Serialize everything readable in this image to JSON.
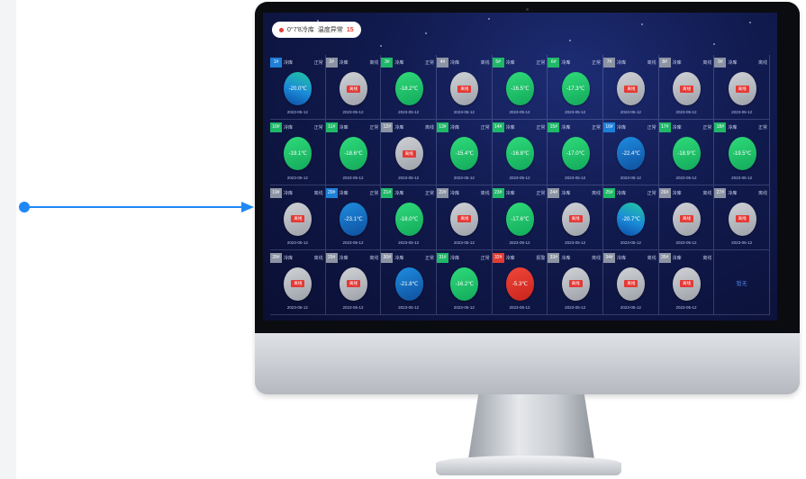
{
  "screen": {
    "header_prefix": "0°7'8冷库",
    "header_alert": "15",
    "header_mid": "温度异常"
  },
  "colors": {
    "connector": "#1e88f5",
    "normal": "#1fb868",
    "low": "#1e7fd8",
    "offline": "#8c93a3",
    "alarm": "#e23b32"
  },
  "cells": [
    {
      "tag": "1#",
      "tag_color": "blue",
      "name": "冷库",
      "state": "正常",
      "disc": "blue-green",
      "value": "-20.0℃",
      "foot": "2023-05-12"
    },
    {
      "tag": "2#",
      "tag_color": "gray",
      "name": "冷库",
      "state": "离线",
      "disc": "gray",
      "value": "离线",
      "foot": "2023-05-12"
    },
    {
      "tag": "3#",
      "tag_color": "green",
      "name": "冷库",
      "state": "正常",
      "disc": "green",
      "value": "-18.2℃",
      "foot": "2023-05-12"
    },
    {
      "tag": "4#",
      "tag_color": "gray",
      "name": "冷库",
      "state": "离线",
      "disc": "gray",
      "value": "离线",
      "foot": "2023-05-12"
    },
    {
      "tag": "5#",
      "tag_color": "green",
      "name": "冷库",
      "state": "正常",
      "disc": "green",
      "value": "-16.5℃",
      "foot": "2023-05-12"
    },
    {
      "tag": "6#",
      "tag_color": "green",
      "name": "冷库",
      "state": "正常",
      "disc": "green",
      "value": "-17.3℃",
      "foot": "2023-05-12"
    },
    {
      "tag": "7#",
      "tag_color": "gray",
      "name": "冷库",
      "state": "离线",
      "disc": "gray",
      "value": "离线",
      "foot": "2023-05-12"
    },
    {
      "tag": "8#",
      "tag_color": "gray",
      "name": "冷库",
      "state": "离线",
      "disc": "gray",
      "value": "离线",
      "foot": "2023-05-12"
    },
    {
      "tag": "9#",
      "tag_color": "gray",
      "name": "冷库",
      "state": "离线",
      "disc": "gray",
      "value": "离线",
      "foot": "2023-05-12"
    },
    {
      "tag": "10#",
      "tag_color": "green",
      "name": "冷库",
      "state": "正常",
      "disc": "green",
      "value": "-19.1℃",
      "foot": "2023-05-12"
    },
    {
      "tag": "11#",
      "tag_color": "green",
      "name": "冷库",
      "state": "正常",
      "disc": "green",
      "value": "-18.6℃",
      "foot": "2023-05-12"
    },
    {
      "tag": "12#",
      "tag_color": "gray",
      "name": "冷库",
      "state": "离线",
      "disc": "gray",
      "value": "离线",
      "foot": "2023-05-12"
    },
    {
      "tag": "13#",
      "tag_color": "green",
      "name": "冷库",
      "state": "正常",
      "disc": "green",
      "value": "-15.4℃",
      "foot": "2023-05-12"
    },
    {
      "tag": "14#",
      "tag_color": "green",
      "name": "冷库",
      "state": "正常",
      "disc": "green",
      "value": "-16.8℃",
      "foot": "2023-05-12"
    },
    {
      "tag": "15#",
      "tag_color": "green",
      "name": "冷库",
      "state": "正常",
      "disc": "green",
      "value": "-17.0℃",
      "foot": "2023-05-12"
    },
    {
      "tag": "16#",
      "tag_color": "blue",
      "name": "冷库",
      "state": "正常",
      "disc": "blue",
      "value": "-22.4℃",
      "foot": "2023-05-12"
    },
    {
      "tag": "17#",
      "tag_color": "green",
      "name": "冷库",
      "state": "正常",
      "disc": "green",
      "value": "-18.9℃",
      "foot": "2023-05-12"
    },
    {
      "tag": "18#",
      "tag_color": "green",
      "name": "冷库",
      "state": "正常",
      "disc": "green",
      "value": "-19.5℃",
      "foot": "2023-05-12"
    },
    {
      "tag": "19#",
      "tag_color": "gray",
      "name": "冷库",
      "state": "离线",
      "disc": "gray",
      "value": "离线",
      "foot": "2023-05-12"
    },
    {
      "tag": "20#",
      "tag_color": "blue",
      "name": "冷库",
      "state": "正常",
      "disc": "blue",
      "value": "-23.1℃",
      "foot": "2023-05-12"
    },
    {
      "tag": "21#",
      "tag_color": "green",
      "name": "冷库",
      "state": "正常",
      "disc": "green",
      "value": "-18.0℃",
      "foot": "2023-05-12"
    },
    {
      "tag": "22#",
      "tag_color": "gray",
      "name": "冷库",
      "state": "离线",
      "disc": "gray",
      "value": "离线",
      "foot": "2023-05-12"
    },
    {
      "tag": "23#",
      "tag_color": "green",
      "name": "冷库",
      "state": "正常",
      "disc": "green",
      "value": "-17.6℃",
      "foot": "2023-05-12"
    },
    {
      "tag": "24#",
      "tag_color": "gray",
      "name": "冷库",
      "state": "离线",
      "disc": "gray",
      "value": "离线",
      "foot": "2023-05-12"
    },
    {
      "tag": "25#",
      "tag_color": "green",
      "name": "冷库",
      "state": "正常",
      "disc": "blue-green",
      "value": "-20.7℃",
      "foot": "2023-05-12"
    },
    {
      "tag": "26#",
      "tag_color": "gray",
      "name": "冷库",
      "state": "离线",
      "disc": "gray",
      "value": "离线",
      "foot": "2023-05-12"
    },
    {
      "tag": "27#",
      "tag_color": "gray",
      "name": "冷库",
      "state": "离线",
      "disc": "gray",
      "value": "离线",
      "foot": "2023-05-12"
    },
    {
      "tag": "28#",
      "tag_color": "gray",
      "name": "冷库",
      "state": "离线",
      "disc": "gray",
      "value": "离线",
      "foot": "2023-05-12"
    },
    {
      "tag": "29#",
      "tag_color": "gray",
      "name": "冷库",
      "state": "离线",
      "disc": "gray",
      "value": "离线",
      "foot": "2023-05-12"
    },
    {
      "tag": "30#",
      "tag_color": "gray",
      "name": "冷库",
      "state": "正常",
      "disc": "blue",
      "value": "-21.8℃",
      "foot": "2023-05-12"
    },
    {
      "tag": "31#",
      "tag_color": "green",
      "name": "冷库",
      "state": "正常",
      "disc": "green",
      "value": "-16.2℃",
      "foot": "2023-05-12"
    },
    {
      "tag": "32#",
      "tag_color": "red",
      "name": "冷库",
      "state": "报警",
      "disc": "red",
      "value": "-5.3℃",
      "foot": "2023-05-12"
    },
    {
      "tag": "33#",
      "tag_color": "gray",
      "name": "冷库",
      "state": "离线",
      "disc": "gray",
      "value": "离线",
      "foot": "2023-05-12"
    },
    {
      "tag": "34#",
      "tag_color": "gray",
      "name": "冷库",
      "state": "离线",
      "disc": "gray",
      "value": "离线",
      "foot": "2023-05-12"
    },
    {
      "tag": "35#",
      "tag_color": "gray",
      "name": "冷库",
      "state": "离线",
      "disc": "gray",
      "value": "离线",
      "foot": "2023-05-12"
    },
    {
      "tag": "",
      "tag_color": "gray",
      "name": "",
      "state": "",
      "disc": "",
      "value": "",
      "foot": "",
      "empty_label": "暂无"
    }
  ]
}
